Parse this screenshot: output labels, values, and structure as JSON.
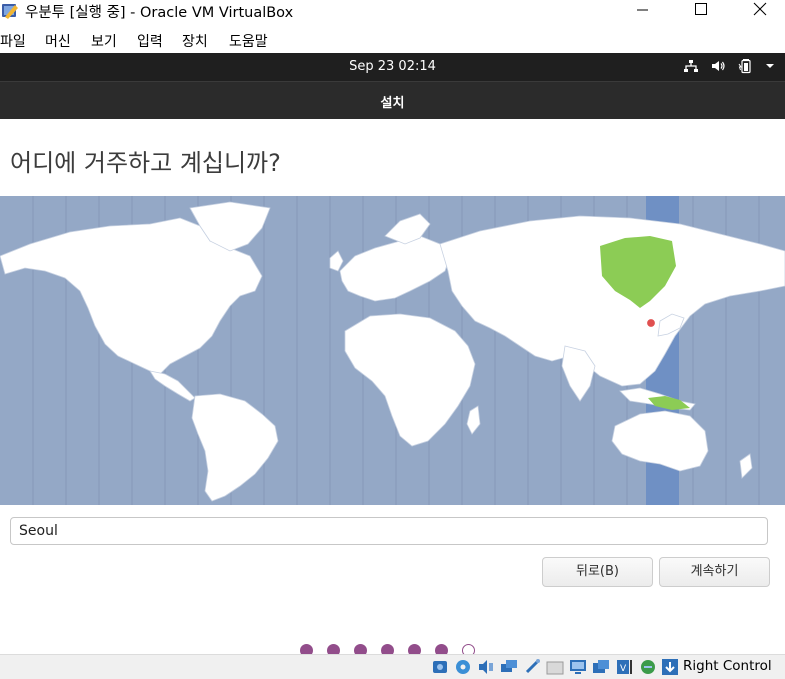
{
  "window": {
    "title": "우분투 [실행 중] - Oracle VM VirtualBox",
    "icon": "virtualbox-icon",
    "controls": [
      "minimize-icon",
      "maximize-icon",
      "close-icon"
    ]
  },
  "menubar": {
    "items": [
      {
        "label": "파일"
      },
      {
        "label": "머신"
      },
      {
        "label": "보기"
      },
      {
        "label": "입력"
      },
      {
        "label": "장치"
      },
      {
        "label": "도움말"
      }
    ]
  },
  "gnome_topbar": {
    "clock": "Sep 23  02:14",
    "indicators": [
      "network-icon",
      "volume-icon",
      "battery-icon",
      "chevron-down-icon"
    ]
  },
  "installer": {
    "header_title": "설치",
    "question": "어디에 거주하고 계십니까?",
    "selected_timezone_city": "Seoul",
    "map": {
      "ocean_color": "#94a8c6",
      "highlight_band_color": "#6f90c4",
      "highlight_region_color": "#8ccc55",
      "pin_color": "#e05050"
    },
    "city_input": {
      "value": "Seoul"
    },
    "buttons": {
      "back": "뒤로(B)",
      "continue": "계속하기"
    },
    "progress": {
      "total_steps": 7,
      "completed_steps": 6,
      "current_step": 7,
      "accent": "#924d8b"
    }
  },
  "vbox_statusbar": {
    "icons": [
      "hard-disk-icon",
      "optical-disk-icon",
      "audio-icon",
      "network-adapters-icon",
      "usb-icon",
      "shared-folders-icon",
      "display-icon",
      "recording-icon",
      "virtualization-icon",
      "mouse-integration-icon",
      "keyboard-capture-icon"
    ],
    "host_key": "Right Control"
  }
}
